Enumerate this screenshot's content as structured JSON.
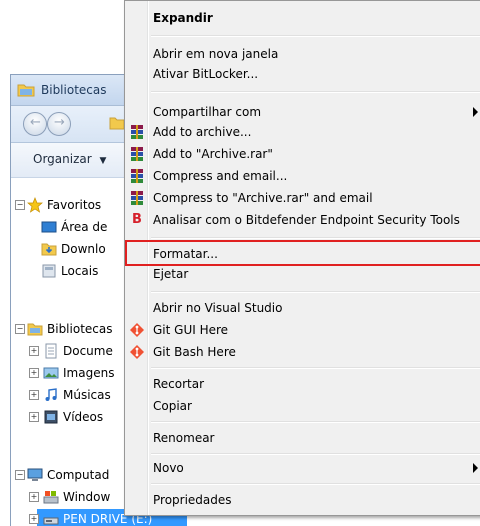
{
  "explorer": {
    "window_title": "Bibliotecas",
    "toolbar_organize": "Organizar",
    "tree": {
      "favorites": "Favoritos",
      "favorites_items": [
        "Área de",
        "Downlo",
        "Locais"
      ],
      "libraries": "Bibliotecas",
      "library_items": [
        "Docume",
        "Imagens",
        "Músicas",
        "Vídeos"
      ],
      "computer": "Computad",
      "computer_items": [
        "Window",
        "PEN DRIVE (E:)"
      ]
    }
  },
  "context_menu": {
    "expand": "Expandir",
    "open_new_window": "Abrir em nova janela",
    "bitlocker": "Ativar BitLocker...",
    "share_with": "Compartilhar com",
    "add_archive": "Add to archive...",
    "add_archive_rar": "Add to \"Archive.rar\"",
    "compress_email": "Compress and email...",
    "compress_rar_email": "Compress to \"Archive.rar\" and email",
    "bitdefender": "Analisar com o Bitdefender Endpoint Security Tools",
    "format": "Formatar...",
    "eject": "Ejetar",
    "visual_studio": "Abrir no Visual Studio",
    "git_gui": "Git GUI Here",
    "git_bash": "Git Bash Here",
    "cut": "Recortar",
    "copy": "Copiar",
    "rename": "Renomear",
    "new": "Novo",
    "properties": "Propriedades"
  },
  "colors": {
    "highlight": "#e02020",
    "selection": "#3399ff",
    "bitdefender": "#d6202b"
  }
}
